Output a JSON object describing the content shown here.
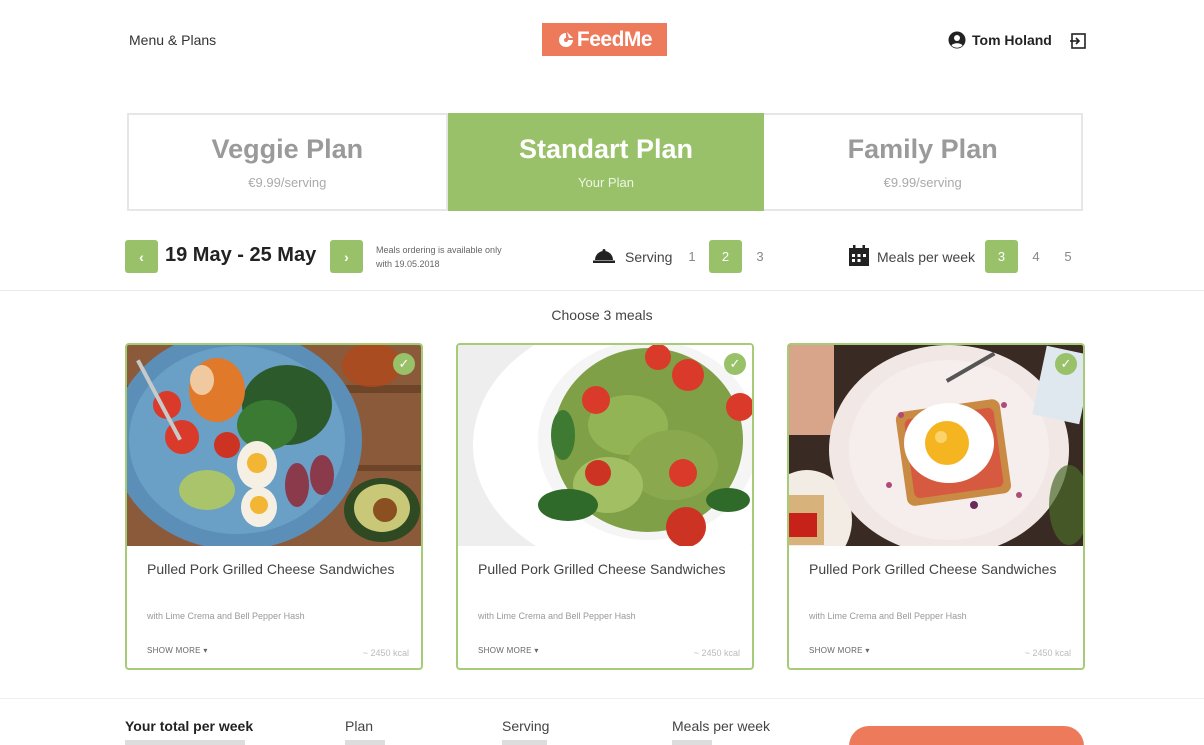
{
  "header": {
    "menu_link": "Menu & Plans",
    "brand": "FeedMe",
    "user_name": "Tom Holand",
    "brand_color": "#ee7a5c",
    "accent_color": "#99c169"
  },
  "plans": [
    {
      "title": "Veggie Plan",
      "subtitle": "€9.99/serving",
      "active": false
    },
    {
      "title": "Standart Plan",
      "subtitle": "Your Plan",
      "active": true
    },
    {
      "title": "Family Plan",
      "subtitle": "€9.99/serving",
      "active": false
    }
  ],
  "week": {
    "range": "19 May - 25 May",
    "prev_icon": "chevron-left-icon",
    "next_icon": "chevron-right-icon",
    "note": "Meals ordering is available only with 19.05.2018"
  },
  "serving": {
    "label": "Serving",
    "options": [
      "1",
      "2",
      "3"
    ],
    "selected": "2",
    "icon": "cloche-icon"
  },
  "meals_per_week": {
    "label": "Meals per week",
    "options": [
      "3",
      "4",
      "5"
    ],
    "selected": "3",
    "icon": "calendar-icon"
  },
  "choose_text": "Choose 3 meals",
  "meals": [
    {
      "name": "Pulled Pork Grilled Cheese Sandwiches",
      "desc": "with Lime Crema and Bell Pepper Hash",
      "more": "SHOW MORE",
      "kcal": "~ 2450 kcal",
      "selected": true,
      "image": "salad-bowl-eggs-avocado"
    },
    {
      "name": "Pulled Pork Grilled Cheese Sandwiches",
      "desc": "with Lime Crema and Bell Pepper Hash",
      "more": "SHOW MORE",
      "kcal": "~ 2450 kcal",
      "selected": true,
      "image": "pesto-farfalle-tomatoes"
    },
    {
      "name": "Pulled Pork Grilled Cheese Sandwiches",
      "desc": "with Lime Crema and Bell Pepper Hash",
      "more": "SHOW MORE",
      "kcal": "~ 2450 kcal",
      "selected": true,
      "image": "fried-egg-toast-plate"
    }
  ],
  "footer": {
    "total_label": "Your total per week",
    "plan_label": "Plan",
    "serving_label": "Serving",
    "meals_label": "Meals per week"
  }
}
